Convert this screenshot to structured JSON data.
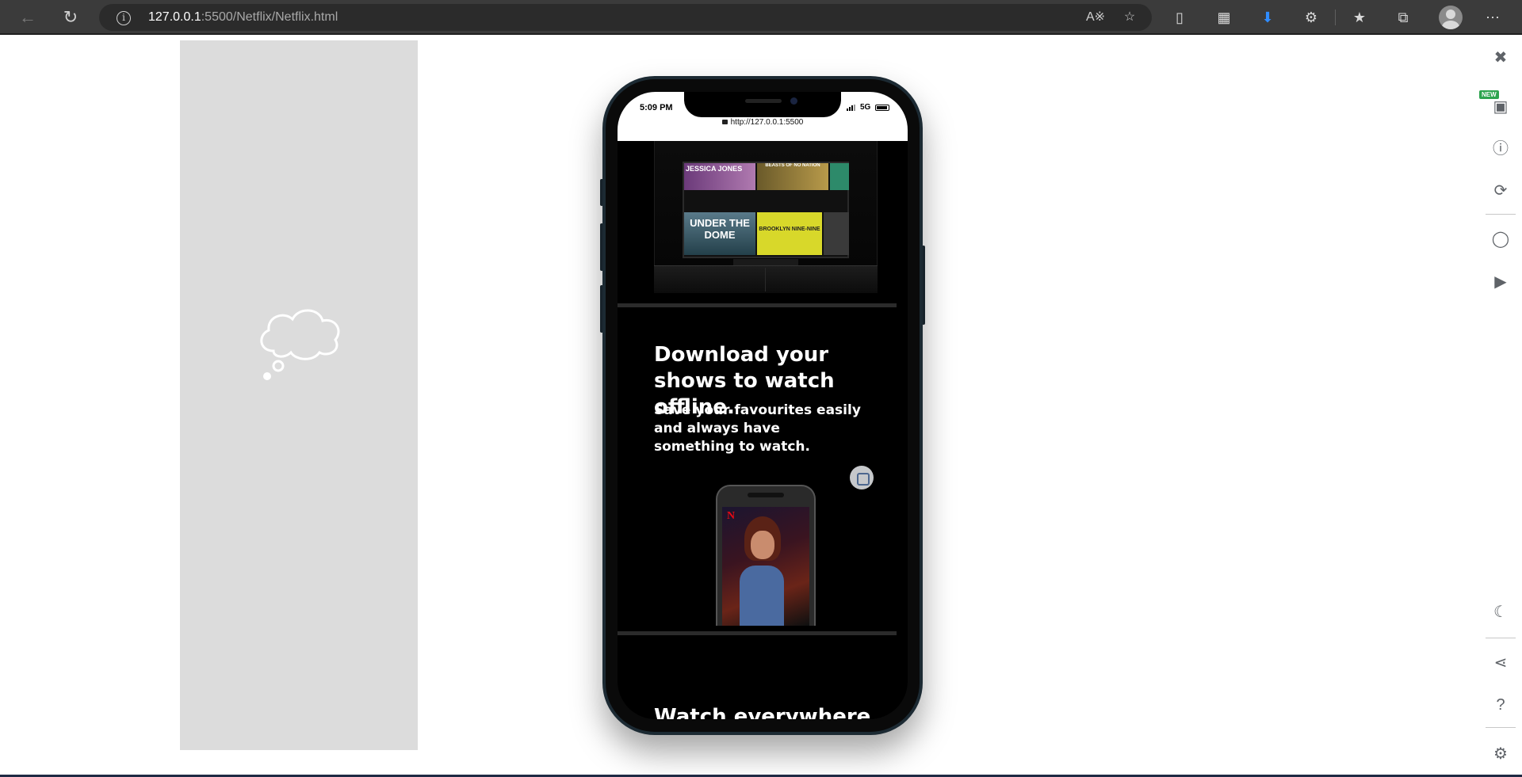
{
  "browser": {
    "url_host": "127.0.0.1",
    "url_rest": ":5500/Netflix/Netflix.html"
  },
  "phone": {
    "status_time": "5:09 PM",
    "network": "5G",
    "address": "http://127.0.0.1:5500"
  },
  "netflix": {
    "tv_tiles": [
      "JESSICA JONES",
      "BEASTS OF NO NATION",
      "UNDER THE DOME",
      "BROOKLYN NINE-NINE"
    ],
    "headline": "Download your shows to watch offline.",
    "subline": [
      "Save your favourites easily and always have",
      "something to watch."
    ],
    "next_headline_partial": "Watch everywhere.",
    "promo_logo": "N"
  }
}
